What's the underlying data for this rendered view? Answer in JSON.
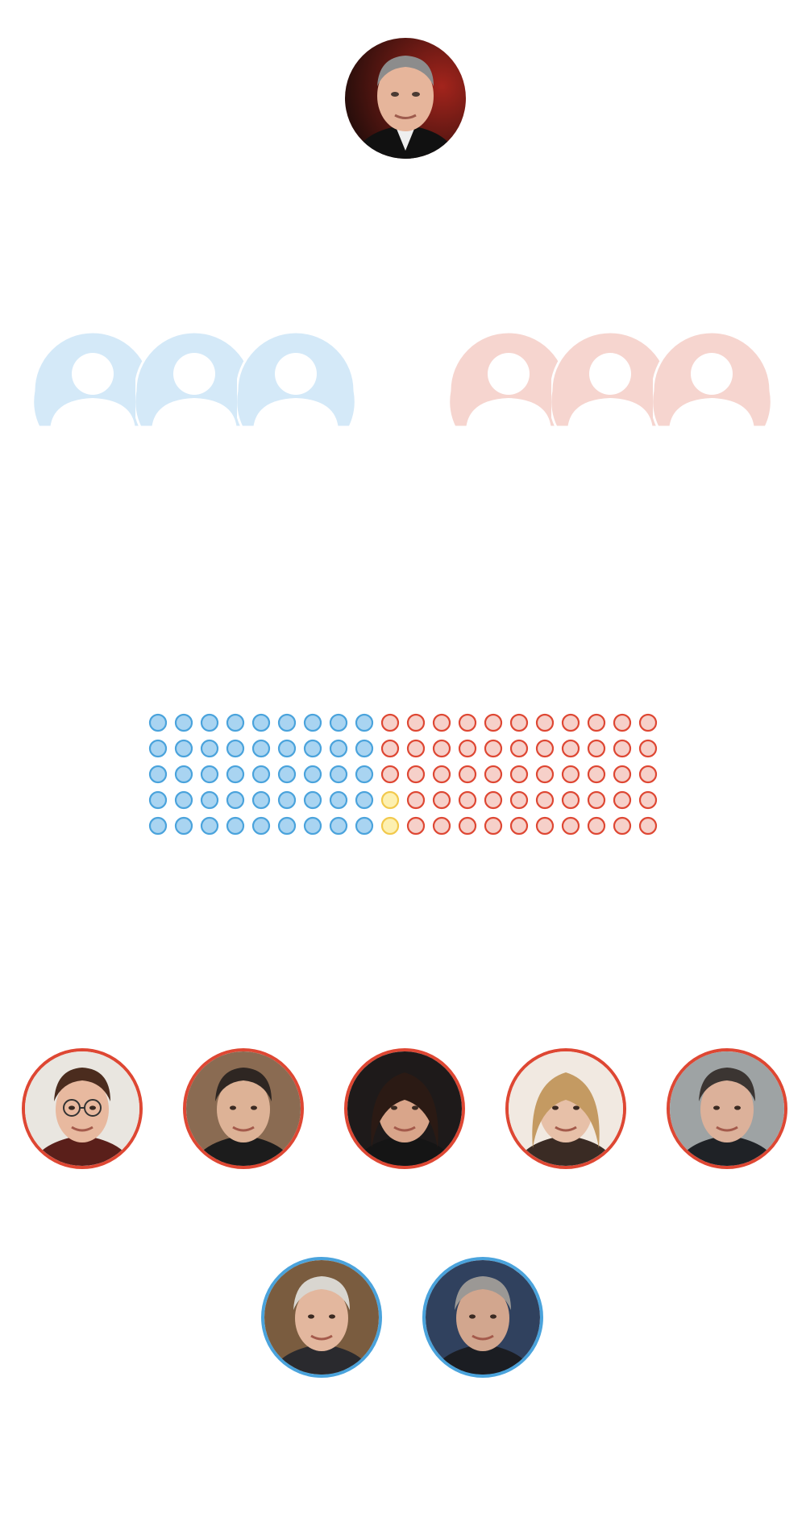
{
  "colors": {
    "democrat_fill": "#a9d4f1",
    "democrat_stroke": "#4aa3dc",
    "republican_fill": "#f6d0c9",
    "republican_stroke": "#de4733",
    "independent_fill": "#fdf0b0",
    "independent_stroke": "#f2c94c",
    "democrat_silhouette": "#d4e9f8",
    "republican_silhouette": "#f6d5cf",
    "republican_ring": "#de4733",
    "democrat_ring": "#4aa3dc"
  },
  "presiding": {
    "icon": "chief-justice-portrait",
    "ring": "none"
  },
  "silhouette_groups": [
    {
      "party": "democrat",
      "count": 3,
      "icon": "person-silhouette-icon"
    },
    {
      "party": "republican",
      "count": 3,
      "icon": "person-silhouette-icon"
    }
  ],
  "chart_data": {
    "type": "waffle",
    "rows": 5,
    "columns": 20,
    "fill_order": "column-major",
    "series": [
      {
        "party": "democrat",
        "count": 45
      },
      {
        "party": "independent",
        "count": 2
      },
      {
        "party": "republican",
        "count": 53
      }
    ],
    "independent_positions": [
      [
        3,
        9
      ],
      [
        4,
        9
      ]
    ]
  },
  "portrait_rows": [
    {
      "ring": "republican",
      "portraits": [
        {
          "icon": "senator-portrait-woman-glasses"
        },
        {
          "icon": "senator-portrait-man-dark-hair"
        },
        {
          "icon": "senator-portrait-woman-dark-hair"
        },
        {
          "icon": "senator-portrait-woman-blonde"
        },
        {
          "icon": "senator-portrait-man-gray-hair"
        }
      ]
    },
    {
      "ring": "democrat",
      "portraits": [
        {
          "icon": "senator-portrait-man-smiling"
        },
        {
          "icon": "senator-portrait-man-flag-background"
        }
      ]
    }
  ]
}
